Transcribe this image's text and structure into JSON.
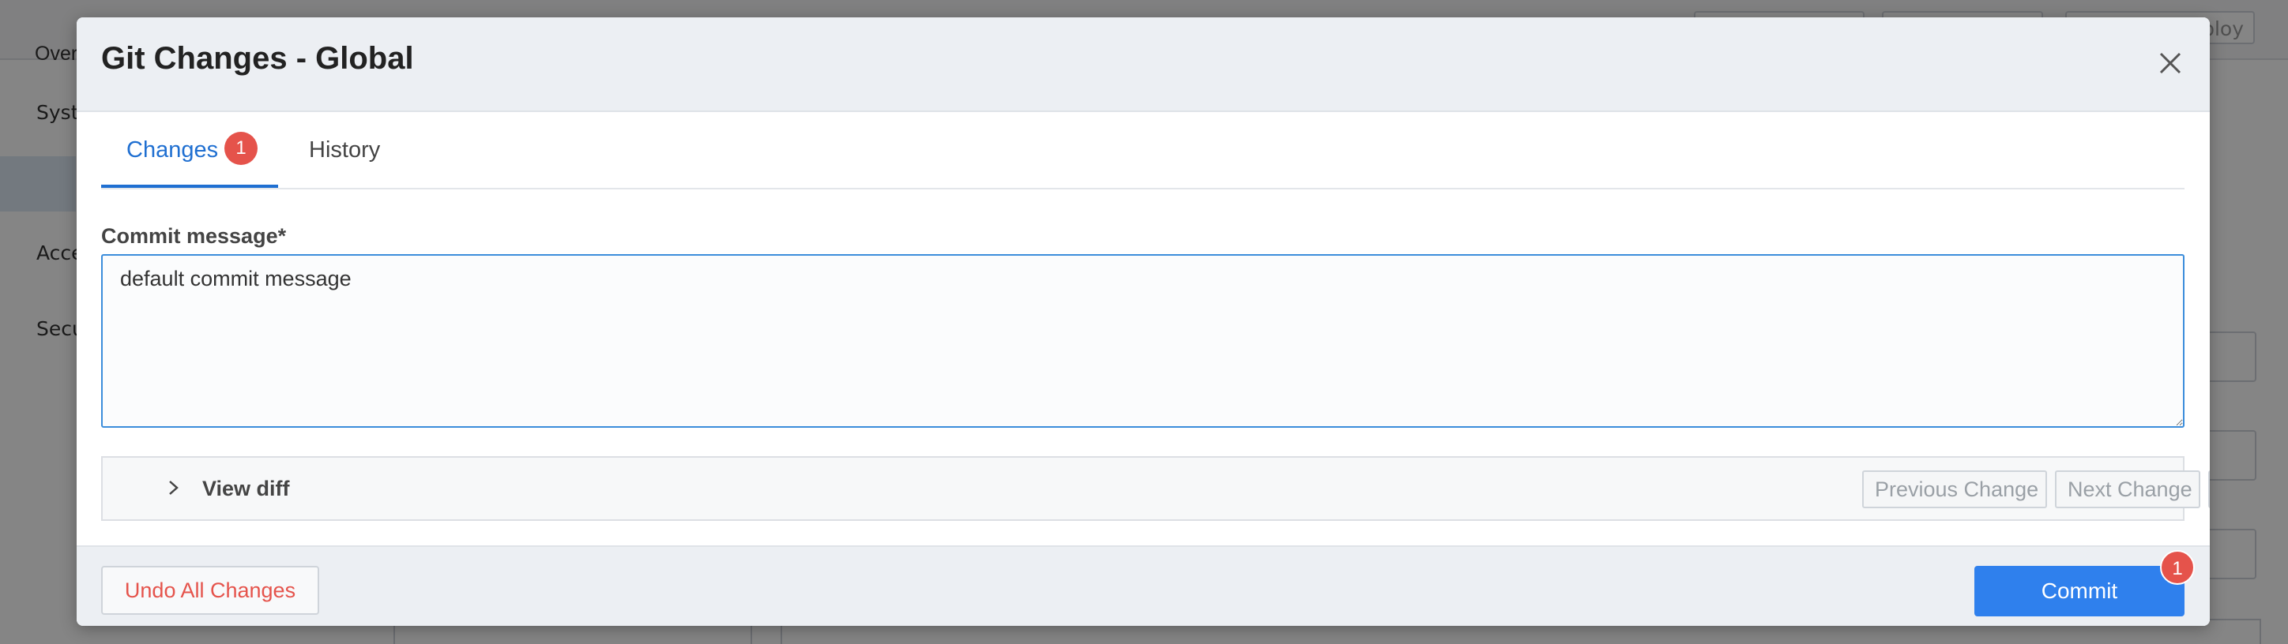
{
  "background": {
    "top_tab": "Overview",
    "top_actions": [
      "",
      "",
      "Deploy"
    ],
    "sidebar_items": [
      "System",
      "Access",
      "Security"
    ]
  },
  "modal": {
    "title": "Git Changes - Global",
    "close_icon": "close-icon"
  },
  "tabs": [
    {
      "label": "Changes",
      "badge": "1",
      "active": true
    },
    {
      "label": "History",
      "active": false
    }
  ],
  "commit_form": {
    "label": "Commit message*",
    "value": "default commit message"
  },
  "diff": {
    "toggle_label": "View diff",
    "previous_label": "Previous Change",
    "next_label": "Next Change",
    "settings_icon": "gear-icon"
  },
  "footer": {
    "undo_label": "Undo All Changes",
    "commit_label": "Commit",
    "commit_badge": "1"
  },
  "colors": {
    "accent": "#2f80ed",
    "danger": "#e5534b",
    "header_bg": "#eceff3"
  }
}
